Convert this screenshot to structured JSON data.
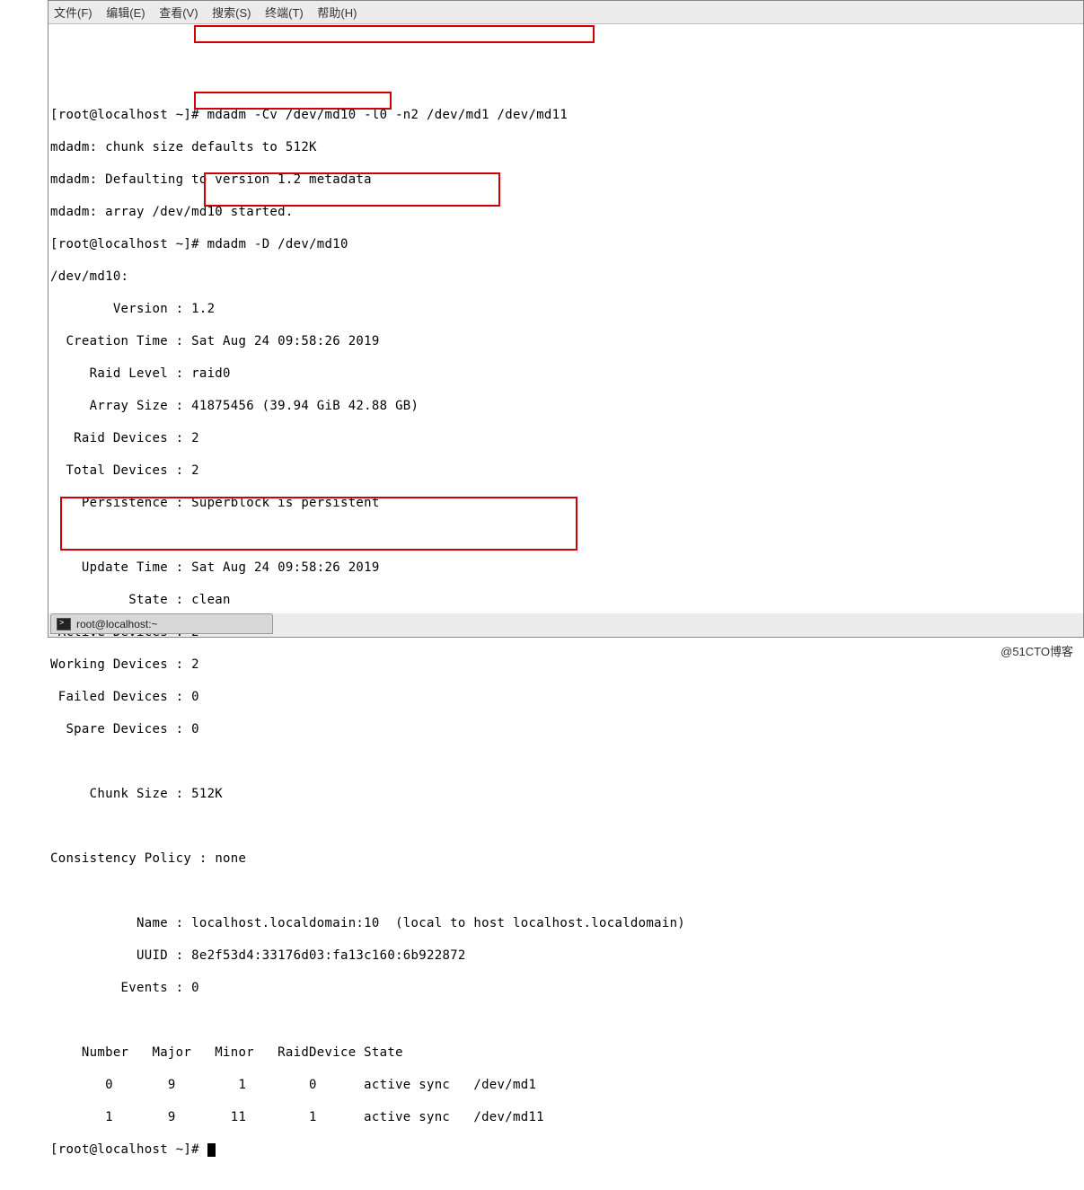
{
  "menubar": {
    "file": "文件(F)",
    "edit": "编辑(E)",
    "view": "查看(V)",
    "search": "搜索(S)",
    "terminal": "终端(T)",
    "help": "帮助(H)"
  },
  "prompt": "[root@localhost ~]#",
  "commands": {
    "cmd1": "mdadm -Cv /dev/md10 -l0 -n2 /dev/md1 /dev/md11",
    "cmd2": "mdadm -D /dev/md10"
  },
  "output": {
    "chunk_default": "mdadm: chunk size defaults to 512K",
    "defaulting": "mdadm: Defaulting to version 1.2 metadata",
    "started": "mdadm: array /dev/md10 started.",
    "device_header": "/dev/md10:",
    "version_label": "        Version : ",
    "version": "1.2",
    "creation_time_label": "  Creation Time : ",
    "creation_time": "Sat Aug 24 09:58:26 2019",
    "raid_level_label": "     Raid Level : ",
    "raid_level": "raid0",
    "array_size_label": "     Array Size : ",
    "array_size": "41875456 (39.94 GiB 42.88 GB)",
    "raid_devices_label": "   Raid Devices : ",
    "raid_devices": "2",
    "total_devices_label": "  Total Devices : ",
    "total_devices": "2",
    "persistence_label": "    Persistence : ",
    "persistence": "Superblock is persistent",
    "update_time_label": "    Update Time : ",
    "update_time": "Sat Aug 24 09:58:26 2019",
    "state_label": "          State : ",
    "state": "clean",
    "active_devices_label": " Active Devices : ",
    "active_devices": "2",
    "working_devices_label": "Working Devices : ",
    "working_devices": "2",
    "failed_devices_label": " Failed Devices : ",
    "failed_devices": "0",
    "spare_devices_label": "  Spare Devices : ",
    "spare_devices": "0",
    "chunk_size_label": "     Chunk Size : ",
    "chunk_size": "512K",
    "consistency_label": "Consistency Policy : ",
    "consistency": "none",
    "name_label": "           Name : ",
    "name": "localhost.localdomain:10  (local to host localhost.localdomain)",
    "uuid_label": "           UUID : ",
    "uuid": "8e2f53d4:33176d03:fa13c160:6b922872",
    "events_label": "         Events : ",
    "events": "0",
    "table_header": "    Number   Major   Minor   RaidDevice State",
    "row0": "       0       9        1        0      active sync   /dev/md1",
    "row1": "       1       9       11        1      active sync   /dev/md11"
  },
  "taskbar": {
    "title": "root@localhost:~"
  },
  "watermark": "@51CTO博客"
}
